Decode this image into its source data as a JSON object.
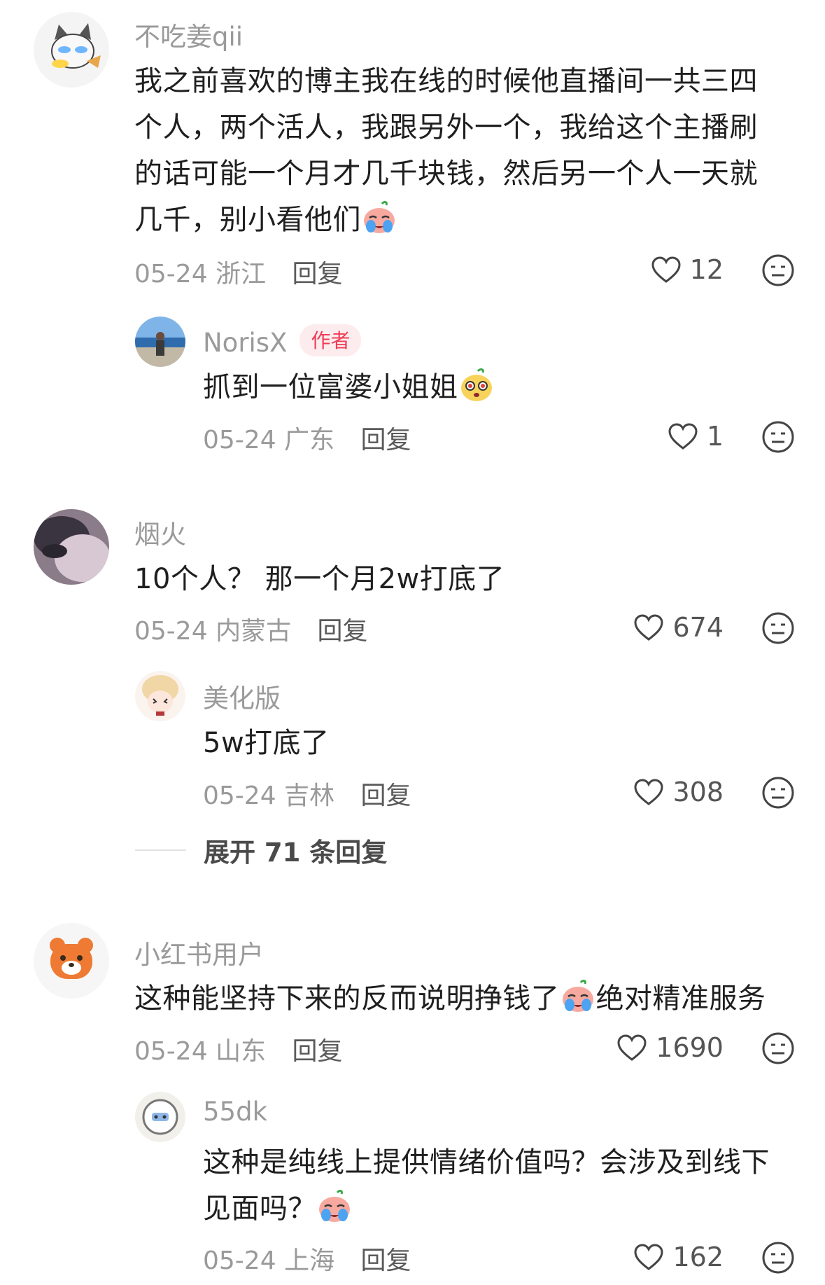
{
  "comments": [
    {
      "username": "不吃姜qii",
      "text": "我之前喜欢的博主我在线的时候他直播间一共三四个人，两个活人，我跟另外一个，我给这个主播刷的话可能一个月才几千块钱，然后另一个人一天就几千，别小看他们",
      "emoji_end": "crying-face-emoji",
      "date": "05-24",
      "location": "浙江",
      "reply_label": "回复",
      "likes": "12",
      "replies": [
        {
          "username": "NorisX",
          "badge": "作者",
          "text": "抓到一位富婆小姐姐",
          "emoji_end": "starry-eyes-emoji",
          "date": "05-24",
          "location": "广东",
          "reply_label": "回复",
          "likes": "1"
        }
      ]
    },
    {
      "username": "烟火",
      "text": "10个人？ 那一个月2w打底了",
      "date": "05-24",
      "location": "内蒙古",
      "reply_label": "回复",
      "likes": "674",
      "replies": [
        {
          "username": "美化版",
          "text": "5w打底了",
          "date": "05-24",
          "location": "吉林",
          "reply_label": "回复",
          "likes": "308"
        }
      ],
      "expand_label": "展开 71 条回复"
    },
    {
      "username": "小红书用户",
      "text_before_emoji": "这种能坚持下来的反而说明挣钱了",
      "text_after_emoji": "绝对精准服务",
      "emoji_mid": "crying-face-emoji",
      "date": "05-24",
      "location": "山东",
      "reply_label": "回复",
      "likes": "1690",
      "replies": [
        {
          "username": "55dk",
          "text": "这种是纯线上提供情绪价值吗？会涉及到线下见面吗？",
          "emoji_end": "crying-face-emoji",
          "date": "05-24",
          "location": "上海",
          "reply_label": "回复",
          "likes": "162"
        }
      ]
    }
  ],
  "colors": {
    "text_primary": "#1f1f1f",
    "text_secondary": "#9a9a9a",
    "author_badge_bg": "#fdecee",
    "author_badge_text": "#f03a55"
  }
}
